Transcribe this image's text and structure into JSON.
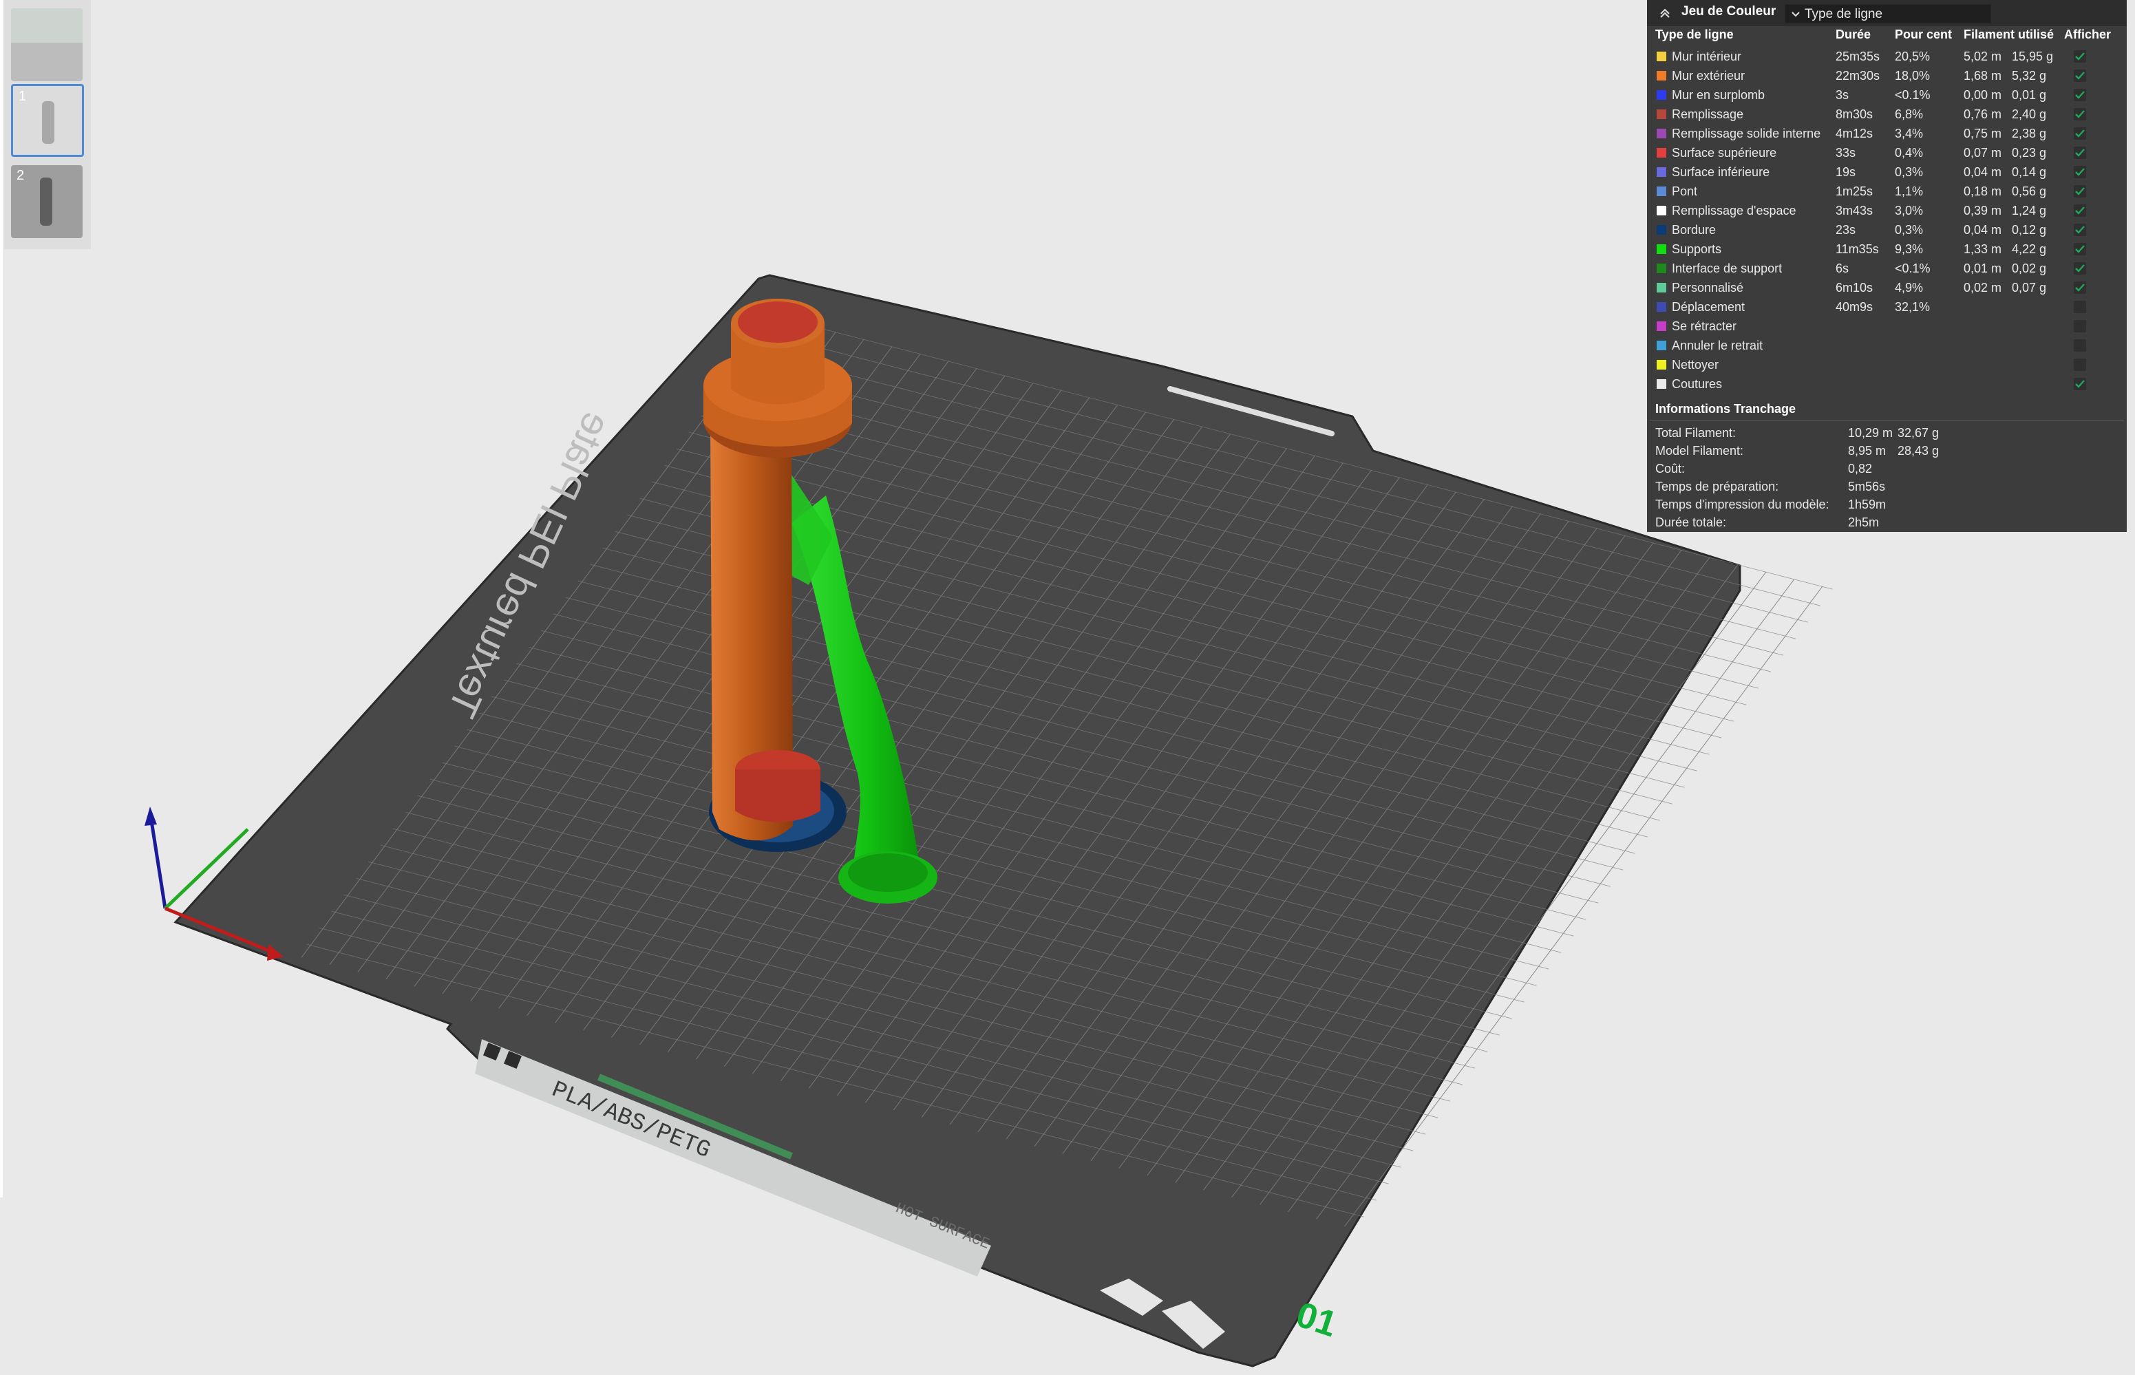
{
  "legend": {
    "title": "Jeu de Couleur",
    "view_type": "Type de ligne",
    "headers": {
      "type": "Type de ligne",
      "duration": "Durée",
      "percent": "Pour cent",
      "filament": "Filament utilisé",
      "show": "Afficher"
    },
    "rows": [
      {
        "name": "Mur intérieur",
        "color": "#f2d040",
        "time": "25m35s",
        "pct": "20,5%",
        "len": "5,02 m",
        "wt": "15,95 g",
        "shown": true
      },
      {
        "name": "Mur extérieur",
        "color": "#f07c2a",
        "time": "22m30s",
        "pct": "18,0%",
        "len": "1,68 m",
        "wt": "5,32 g",
        "shown": true
      },
      {
        "name": "Mur en surplomb",
        "color": "#2d3cf0",
        "time": "3s",
        "pct": "<0.1%",
        "len": "0,00 m",
        "wt": "0,01 g",
        "shown": true
      },
      {
        "name": "Remplissage",
        "color": "#b8463c",
        "time": "8m30s",
        "pct": "6,8%",
        "len": "0,76 m",
        "wt": "2,40 g",
        "shown": true
      },
      {
        "name": "Remplissage solide interne",
        "color": "#9a48b4",
        "time": "4m12s",
        "pct": "3,4%",
        "len": "0,75 m",
        "wt": "2,38 g",
        "shown": true
      },
      {
        "name": "Surface supérieure",
        "color": "#e43e3e",
        "time": "33s",
        "pct": "0,4%",
        "len": "0,07 m",
        "wt": "0,23 g",
        "shown": true
      },
      {
        "name": "Surface inférieure",
        "color": "#6a6ae0",
        "time": "19s",
        "pct": "0,3%",
        "len": "0,04 m",
        "wt": "0,14 g",
        "shown": true
      },
      {
        "name": "Pont",
        "color": "#5c8ad4",
        "time": "1m25s",
        "pct": "1,1%",
        "len": "0,18 m",
        "wt": "0,56 g",
        "shown": true
      },
      {
        "name": "Remplissage d'espace",
        "color": "#ffffff",
        "time": "3m43s",
        "pct": "3,0%",
        "len": "0,39 m",
        "wt": "1,24 g",
        "shown": true
      },
      {
        "name": "Bordure",
        "color": "#0c3c78",
        "time": "23s",
        "pct": "0,3%",
        "len": "0,04 m",
        "wt": "0,12 g",
        "shown": true
      },
      {
        "name": "Supports",
        "color": "#10e010",
        "time": "11m35s",
        "pct": "9,3%",
        "len": "1,33 m",
        "wt": "4,22 g",
        "shown": true
      },
      {
        "name": "Interface de support",
        "color": "#1e8a1e",
        "time": "6s",
        "pct": "<0.1%",
        "len": "0,01 m",
        "wt": "0,02 g",
        "shown": true
      },
      {
        "name": "Personnalisé",
        "color": "#5ecc98",
        "time": "6m10s",
        "pct": "4,9%",
        "len": "0,02 m",
        "wt": "0,07 g",
        "shown": true
      },
      {
        "name": "Déplacement",
        "color": "#3c4cb4",
        "time": "40m9s",
        "pct": "32,1%",
        "len": "",
        "wt": "",
        "shown": false
      },
      {
        "name": "Se rétracter",
        "color": "#c83ccc",
        "time": "",
        "pct": "",
        "len": "",
        "wt": "",
        "shown": false
      },
      {
        "name": "Annuler le retrait",
        "color": "#40a0d8",
        "time": "",
        "pct": "",
        "len": "",
        "wt": "",
        "shown": false
      },
      {
        "name": "Nettoyer",
        "color": "#f0f020",
        "time": "",
        "pct": "",
        "len": "",
        "wt": "",
        "shown": false
      },
      {
        "name": "Coutures",
        "color": "#eaeaea",
        "time": "",
        "pct": "",
        "len": "",
        "wt": "",
        "shown": true
      }
    ]
  },
  "slicing_info": {
    "title": "Informations Tranchage",
    "rows": [
      {
        "label": "Total Filament:",
        "v1": "10,29 m",
        "v2": "32,67 g"
      },
      {
        "label": "Model Filament:",
        "v1": "8,95 m",
        "v2": "28,43 g"
      },
      {
        "label": "Coût:",
        "v1": "0,82",
        "v2": ""
      },
      {
        "label": "Temps de préparation:",
        "v1": "5m56s",
        "v2": ""
      },
      {
        "label": "Temps d'impression du modèle:",
        "v1": "1h59m",
        "v2": ""
      },
      {
        "label": "Durée totale:",
        "v1": "2h5m",
        "v2": ""
      }
    ]
  },
  "plate": {
    "name": "Textured PEI Plate",
    "materials": "PLA/ABS/PETG",
    "warning": "HOT SURFACE",
    "number": "01"
  },
  "thumbnails": [
    {
      "num": ""
    },
    {
      "num": "1"
    },
    {
      "num": "2"
    }
  ],
  "colors": {
    "bed": "#4a4a4a",
    "model_orange": "#c5621e",
    "support_green": "#12c312",
    "top_red": "#c13a2c"
  }
}
